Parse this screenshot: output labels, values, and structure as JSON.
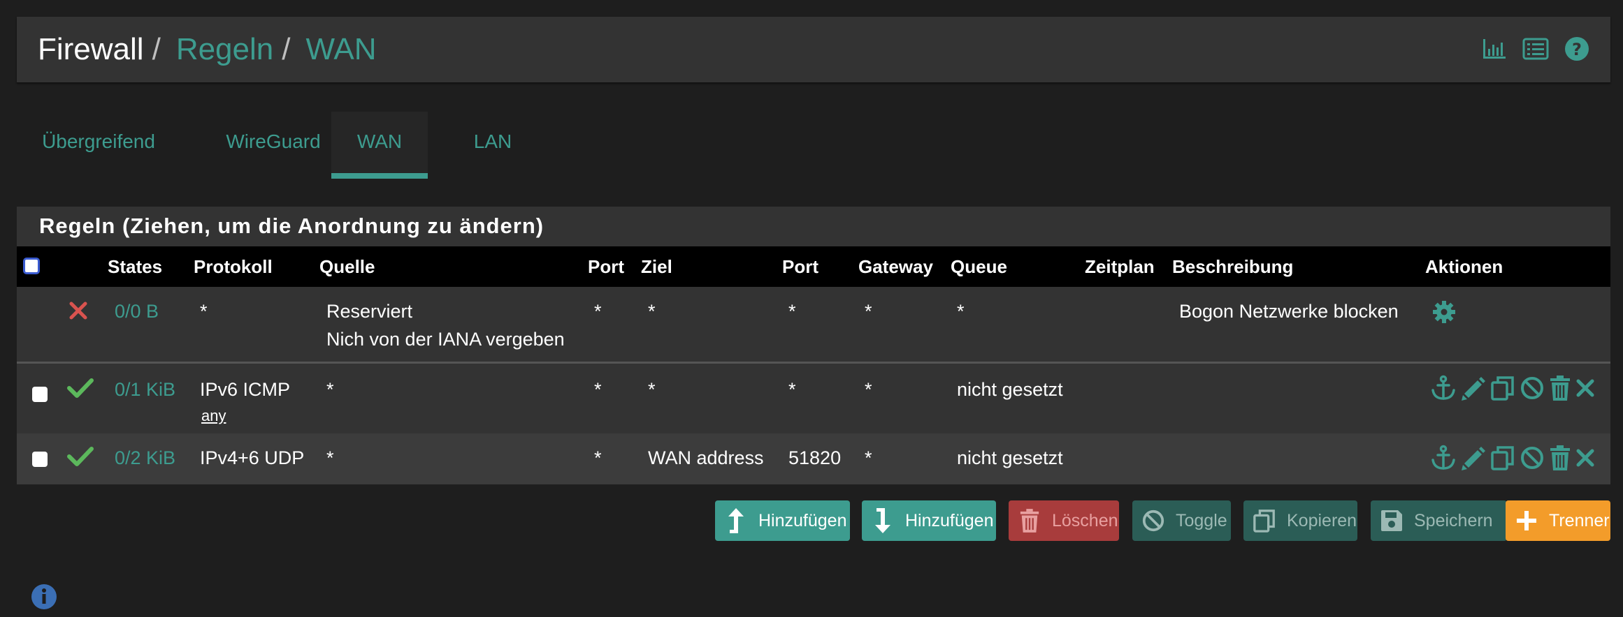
{
  "breadcrumb": {
    "first": "Firewall",
    "sep": "/",
    "second": "Regeln",
    "third": "WAN"
  },
  "header_icons": [
    "chart-icon",
    "list-icon",
    "help-icon"
  ],
  "tabs": [
    {
      "label": "Übergreifend",
      "active": false
    },
    {
      "label": "WireGuard",
      "active": false
    },
    {
      "label": "WAN",
      "active": true
    },
    {
      "label": "LAN",
      "active": false
    }
  ],
  "panel": {
    "title": "Regeln (Ziehen, um die Anordnung zu ändern)",
    "columns": [
      "States",
      "Protokoll",
      "Quelle",
      "Port",
      "Ziel",
      "Port",
      "Gateway",
      "Queue",
      "Zeitplan",
      "Beschreibung",
      "Aktionen"
    ],
    "rows": [
      {
        "status": "block",
        "states": "0/0 B",
        "protocol": "*",
        "protocol_sub": "",
        "source": "Reserviert",
        "source_line2": "Nich von der IANA vergeben",
        "port": "*",
        "destination": "*",
        "dest_port": "*",
        "gateway": "*",
        "queue": "*",
        "schedule": "",
        "description": "Bogon Netzwerke blocken"
      },
      {
        "status": "pass",
        "states": "0/1 KiB",
        "protocol": "IPv6 ICMP",
        "protocol_sub": "any",
        "source": "*",
        "port": "*",
        "destination": "*",
        "dest_port": "*",
        "gateway": "*",
        "queue": "nicht gesetzt",
        "schedule": "",
        "description": ""
      },
      {
        "status": "pass",
        "states": "0/2 KiB",
        "protocol": "IPv4+6 UDP",
        "protocol_sub": "",
        "source": "*",
        "port": "*",
        "destination": "WAN address",
        "dest_port": "51820",
        "gateway": "*",
        "queue": "nicht gesetzt",
        "schedule": "",
        "description": ""
      }
    ]
  },
  "buttons": {
    "add_top": "Hinzufügen",
    "add_bottom": "Hinzufügen",
    "delete": "Löschen",
    "toggle": "Toggle",
    "copy": "Kopieren",
    "save": "Speichern",
    "separator": "Trenner"
  },
  "colors": {
    "accent": "#3d9c8f",
    "danger": "#a83c3c",
    "warning": "#f39c2a",
    "pass": "#5cb85c",
    "block": "#d9534f"
  }
}
